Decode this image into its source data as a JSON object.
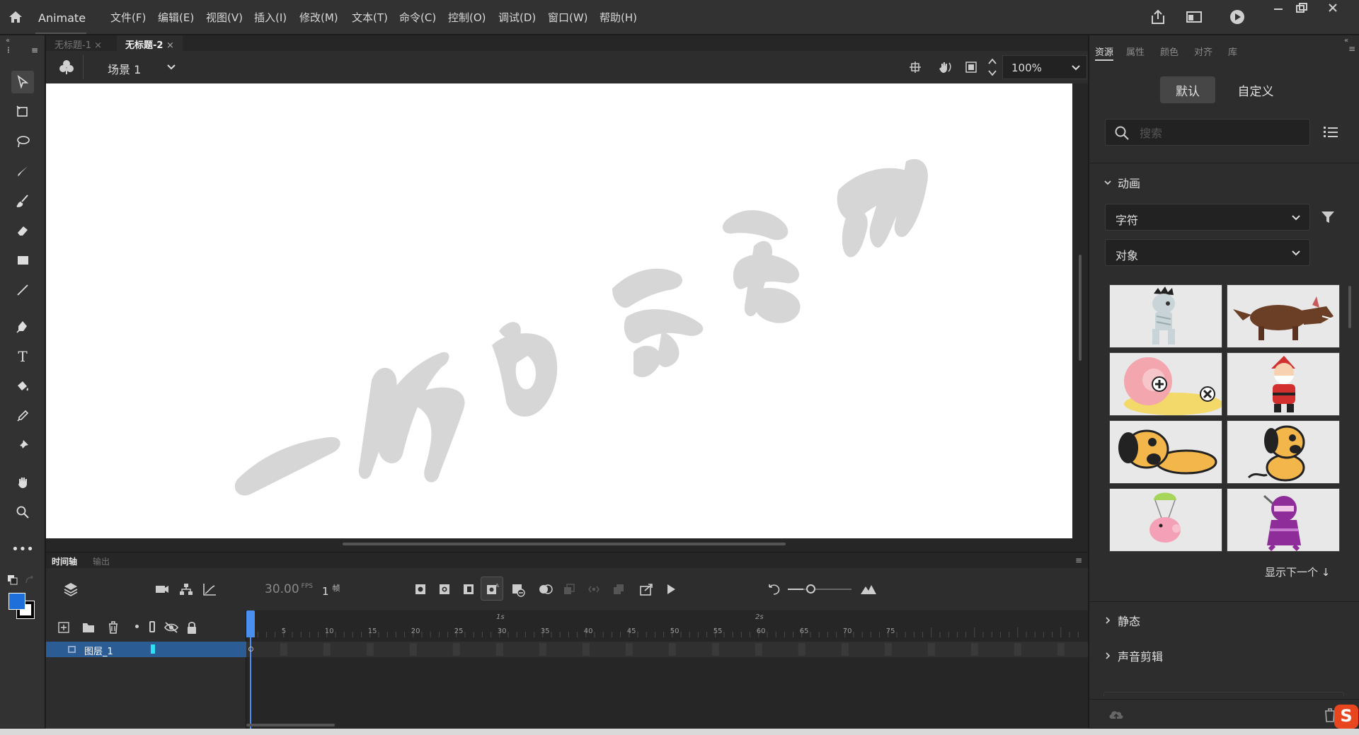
{
  "app": {
    "name": "Animate"
  },
  "menu": [
    "文件(F)",
    "编辑(E)",
    "视图(V)",
    "插入(I)",
    "修改(M)",
    "文本(T)",
    "命令(C)",
    "控制(O)",
    "调试(D)",
    "窗口(W)",
    "帮助(H)"
  ],
  "doc_tabs": [
    {
      "label": "无标题-1",
      "active": false
    },
    {
      "label": "无标题-2",
      "active": true
    }
  ],
  "editbar": {
    "scene": "场景 1",
    "zoom": "100%"
  },
  "watermark": {
    "text": "一个白衣书"
  },
  "timeline": {
    "tabs": [
      "时间轴",
      "输出"
    ],
    "fps": "30.00",
    "fps_unit": "FPS",
    "frame": "1",
    "frame_unit": "帧",
    "ruler_marks": [
      "5",
      "10",
      "15",
      "20",
      "25",
      "30",
      "35",
      "40",
      "45",
      "50",
      "55",
      "60",
      "65",
      "70",
      "75"
    ],
    "time_marks": [
      "1s",
      "2s"
    ],
    "layers": [
      {
        "name": "图层_1"
      }
    ]
  },
  "right_panel": {
    "tabs": [
      "资源",
      "属性",
      "颜色",
      "对齐",
      "库"
    ],
    "seg_default": "默认",
    "seg_custom": "自定义",
    "search_placeholder": "搜索",
    "section_animation": "动画",
    "dropdown_character": "字符",
    "dropdown_object": "对象",
    "show_next": "显示下一个",
    "section_static": "静态",
    "section_audio": "声音剪辑"
  },
  "colors": {
    "stroke": "#000000",
    "fill": "#1e6fd9",
    "accent": "#3f8ef0"
  }
}
